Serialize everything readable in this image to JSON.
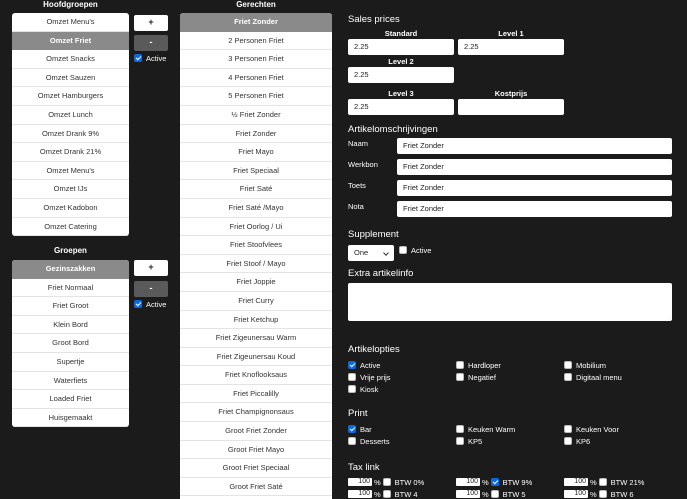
{
  "hoofdgroepen": {
    "title": "Hoofdgroepen",
    "items": [
      "Omzet Menu's",
      "Omzet Friet",
      "Omzet Snacks",
      "Omzet Sauzen",
      "Omzet Hamburgers",
      "Omzet Lunch",
      "Omzet Drank 9%",
      "Omzet Drank 21%",
      "Omzet Menu's",
      "Omzet IJs",
      "Omzet Kadobon",
      "Omzet Catering"
    ],
    "selected_index": 1,
    "add_label": "+",
    "remove_label": "-",
    "active_label": "Active"
  },
  "groepen": {
    "title": "Groepen",
    "items": [
      "Gezinszakken",
      "Friet Normaal",
      "Friet Groot",
      "Klein Bord",
      "Groot Bord",
      "Supertje",
      "Waterfiets",
      "Loaded Friet",
      "Huisgemaakt"
    ],
    "selected_index": 0,
    "add_label": "+",
    "remove_label": "-",
    "active_label": "Active"
  },
  "gerechten": {
    "title": "Gerechten",
    "items": [
      "Friet Zonder",
      "2 Personen Friet",
      "3 Personen Friet",
      "4 Personen Friet",
      "5 Personen Friet",
      "½ Friet Zonder",
      "Friet Zonder",
      "Friet Mayo",
      "Friet Speciaal",
      "Friet Saté",
      "Friet Saté /Mayo",
      "Friet Oorlog / Ui",
      "Friet Stoofvlees",
      "Friet Stoof / Mayo",
      "Friet Joppie",
      "Friet Curry",
      "Friet Ketchup",
      "Friet Zigeunersau Warm",
      "Friet Zigeunersau Koud",
      "Friet Knoflooksaus",
      "Friet Piccalilly",
      "Friet Champignonsaus",
      "Groot Friet Zonder",
      "Groot Friet Mayo",
      "Groot Friet Speciaal",
      "Groot Friet Saté"
    ],
    "selected_index": 0
  },
  "sales_prices": {
    "title": "Sales prices",
    "standard_label": "Standard",
    "standard_value": "2.25",
    "level1_label": "Level 1",
    "level1_value": "2.25",
    "level2_label": "Level 2",
    "level2_value": "2.25",
    "level3_label": "Level 3",
    "level3_value": "2.25",
    "kostprijs_label": "Kostprijs",
    "kostprijs_value": ""
  },
  "omschrijvingen": {
    "title": "Artikelomschrijvingen",
    "naam_label": "Naam",
    "naam_value": "Friet Zonder",
    "werkbon_label": "Werkbon",
    "werkbon_value": "Friet Zonder",
    "toets_label": "Toets",
    "toets_value": "Friet Zonder",
    "nota_label": "Nota",
    "nota_value": "Friet Zonder"
  },
  "supplement": {
    "title": "Supplement",
    "select_value": "One",
    "active_label": "Active"
  },
  "extra": {
    "title": "Extra artikelinfo",
    "value": ""
  },
  "artikelopties": {
    "title": "Artikelopties",
    "options": [
      {
        "label": "Active",
        "checked": true
      },
      {
        "label": "Hardloper",
        "checked": false
      },
      {
        "label": "Mobilium",
        "checked": false
      },
      {
        "label": "Vrije prijs",
        "checked": false
      },
      {
        "label": "Negatief",
        "checked": false
      },
      {
        "label": "Digitaal menu",
        "checked": false
      },
      {
        "label": "Kiosk",
        "checked": false
      }
    ]
  },
  "print": {
    "title": "Print",
    "options": [
      {
        "label": "Bar",
        "checked": true
      },
      {
        "label": "Keuken Warm",
        "checked": false
      },
      {
        "label": "Keuken Voor",
        "checked": false
      },
      {
        "label": "Desserts",
        "checked": false
      },
      {
        "label": "KP5",
        "checked": false
      },
      {
        "label": "KP6",
        "checked": false
      }
    ]
  },
  "tax": {
    "title": "Tax link",
    "items": [
      {
        "pct": "100",
        "label": "BTW 0%",
        "checked": false
      },
      {
        "pct": "100",
        "label": "BTW 9%",
        "checked": true
      },
      {
        "pct": "100",
        "label": "BTW 21%",
        "checked": false
      },
      {
        "pct": "100",
        "label": "BTW 4",
        "checked": false
      },
      {
        "pct": "100",
        "label": "BTW 5",
        "checked": false
      },
      {
        "pct": "100",
        "label": "BTW 6",
        "checked": false
      }
    ]
  },
  "colors": {
    "selected": "#8a8a8a",
    "checkbox": "#0a6ae0",
    "background": "#1b1b1b"
  }
}
